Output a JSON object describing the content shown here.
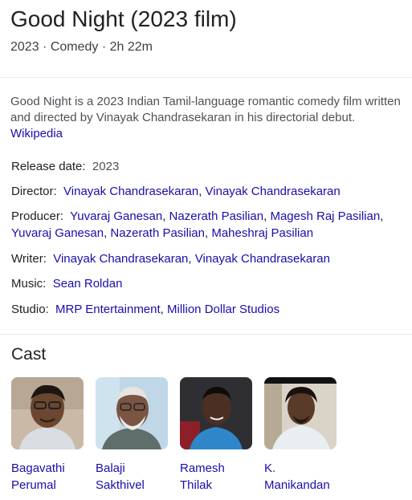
{
  "header": {
    "title": "Good Night (2023 film)",
    "subtitle": "2023 · Comedy · 2h 22m"
  },
  "description": {
    "text": "Good Night is a 2023 Indian Tamil-language romantic comedy film written and directed by Vinayak Chandrasekaran in his directorial debut.",
    "source_link": "Wikipedia"
  },
  "facts": {
    "release": {
      "label": "Release date:",
      "value": "2023"
    },
    "director": {
      "label": "Director:",
      "links": [
        "Vinayak Chandrasekaran",
        "Vinayak Chandrasekaran"
      ]
    },
    "producer": {
      "label": "Producer:",
      "links": [
        "Yuvaraj Ganesan",
        "Nazerath Pasilian",
        "Magesh Raj Pasilian",
        "Yuvaraj Ganesan",
        "Nazerath Pasilian",
        "Maheshraj Pasilian"
      ]
    },
    "writer": {
      "label": "Writer:",
      "links": [
        "Vinayak Chandrasekaran",
        "Vinayak Chandrasekaran"
      ]
    },
    "music": {
      "label": "Music:",
      "links": [
        "Sean Roldan"
      ]
    },
    "studio": {
      "label": "Studio:",
      "links": [
        "MRP Entertainment",
        "Million Dollar Studios"
      ]
    }
  },
  "cast": {
    "heading": "Cast",
    "members": [
      {
        "first": "Bagavathi",
        "last": "Perumal"
      },
      {
        "first": "Balaji",
        "last": "Sakthivel"
      },
      {
        "first": "Ramesh",
        "last": "Thilak"
      },
      {
        "first": "K.",
        "last": "Manikandan"
      }
    ]
  },
  "colors": {
    "link": "#1a0dab",
    "text": "#202124",
    "muted": "#4d5156",
    "divider": "#e8eaed"
  }
}
